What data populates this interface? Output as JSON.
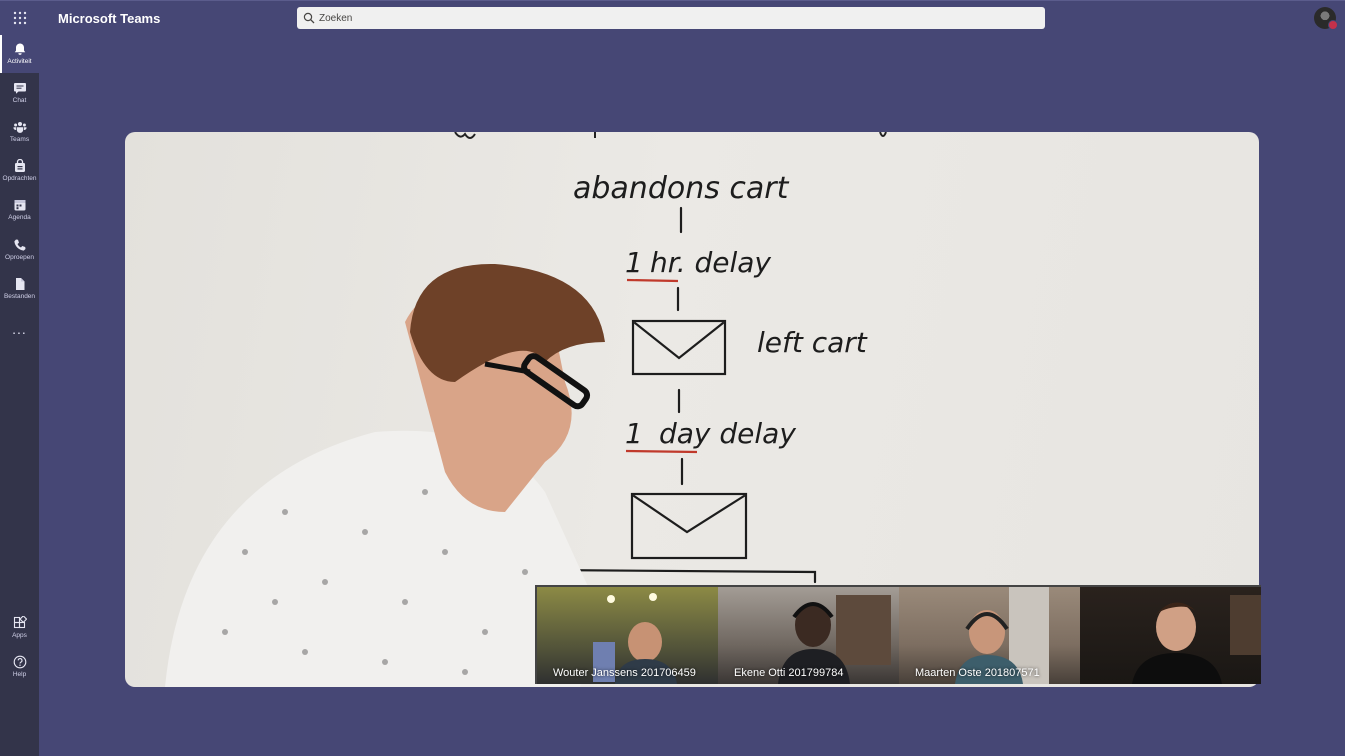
{
  "app": {
    "title": "Microsoft Teams"
  },
  "search": {
    "placeholder": "Zoeken"
  },
  "rail": {
    "items": [
      {
        "label": "Activiteit",
        "icon": "bell-icon",
        "active": true
      },
      {
        "label": "Chat",
        "icon": "chat-icon"
      },
      {
        "label": "Teams",
        "icon": "teams-icon"
      },
      {
        "label": "Opdrachten",
        "icon": "assignments-icon"
      },
      {
        "label": "Agenda",
        "icon": "calendar-icon"
      },
      {
        "label": "Oproepen",
        "icon": "phone-icon"
      },
      {
        "label": "Bestanden",
        "icon": "files-icon"
      }
    ],
    "more": "...",
    "bottom": [
      {
        "label": "Apps",
        "icon": "apps-icon"
      },
      {
        "label": "Help",
        "icon": "help-icon"
      }
    ]
  },
  "whiteboard": {
    "step1": "abandons cart",
    "step2_num": "1",
    "step2_rest": "hr. delay",
    "step3": "left cart",
    "step4_num": "1",
    "step4_rest": "day delay"
  },
  "participants": [
    {
      "name": "Wouter Janssens 201706459"
    },
    {
      "name": "Ekene Otti 201799784"
    },
    {
      "name": "Maarten Oste 201807571"
    },
    {
      "name": ""
    }
  ],
  "colors": {
    "brand": "#464775",
    "rail": "#33344a",
    "underline": "#c0392b",
    "presence": "#c4314b"
  }
}
